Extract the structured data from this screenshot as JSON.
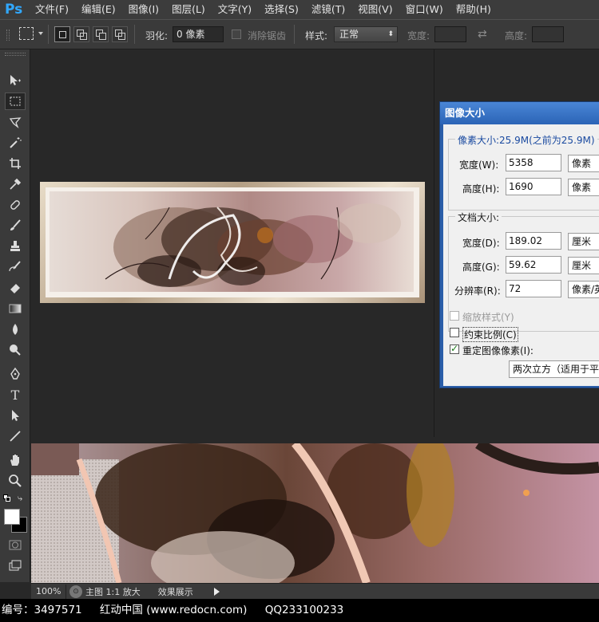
{
  "app": {
    "logo": "Ps"
  },
  "menu": [
    "文件(F)",
    "编辑(E)",
    "图像(I)",
    "图层(L)",
    "文字(Y)",
    "选择(S)",
    "滤镜(T)",
    "视图(V)",
    "窗口(W)",
    "帮助(H)"
  ],
  "options": {
    "feather_label": "羽化:",
    "feather_value": "0 像素",
    "antialias_label": "消除锯齿",
    "style_label": "样式:",
    "style_value": "正常",
    "width_label": "宽度:",
    "height_label": "高度:"
  },
  "tools": [
    "move-tool",
    "marquee-tool",
    "lasso-tool",
    "magic-wand-tool",
    "crop-tool",
    "eyedropper-tool",
    "spot-healing-tool",
    "brush-tool",
    "clone-stamp-tool",
    "history-brush-tool",
    "eraser-tool",
    "gradient-tool",
    "blur-tool",
    "dodge-tool",
    "pen-tool",
    "type-tool",
    "path-selection-tool",
    "line-tool",
    "hand-tool",
    "zoom-tool"
  ],
  "toolbox_text": {
    "type_tool_glyph": "T"
  },
  "dialog": {
    "title": "图像大小",
    "pixel_dimensions_title": "像素大小:25.9M(之前为25.9M)",
    "pixel_width_label": "宽度(W):",
    "pixel_width_value": "5358",
    "pixel_width_unit": "像素",
    "pixel_height_label": "高度(H):",
    "pixel_height_value": "1690",
    "pixel_height_unit": "像素",
    "document_size_title": "文档大小:",
    "doc_width_label": "宽度(D):",
    "doc_width_value": "189.02",
    "doc_width_unit": "厘米",
    "doc_height_label": "高度(G):",
    "doc_height_value": "59.62",
    "doc_height_unit": "厘米",
    "resolution_label": "分辨率(R):",
    "resolution_value": "72",
    "resolution_unit": "像素/英",
    "scale_styles_label": "缩放样式(Y)",
    "constrain_label": "约束比例(C)",
    "resample_label": "重定图像像素(I):",
    "resample_method": "两次立方（适用于平"
  },
  "status": {
    "zoom": "100%",
    "status_icon": "⊙",
    "doc_info": "主图 1:1 放大",
    "effect_label": "效果展示"
  },
  "footer": {
    "id_text": "编号：3497571",
    "site_text": "红动中国 (www.redocn.com)",
    "qq_text": "QQ233100233"
  }
}
